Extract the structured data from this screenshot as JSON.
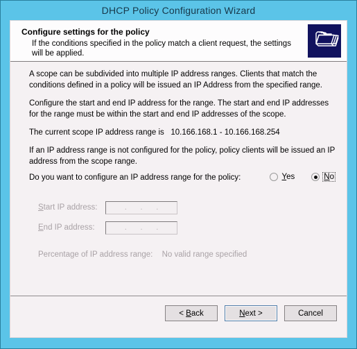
{
  "window": {
    "title": "DHCP Policy Configuration Wizard"
  },
  "banner": {
    "title": "Configure settings for the policy",
    "subtitle": "If the conditions specified in the policy match a client request, the settings will be applied.",
    "icon": "folders-stack-icon"
  },
  "body": {
    "paragraph1": "A scope can be subdivided into multiple IP address ranges. Clients that match the conditions defined in a policy will be issued an IP Address from the specified range.",
    "paragraph2": "Configure the start and end IP address for the range. The start and end IP addresses for the range must be within the start and end IP addresses of the scope.",
    "paragraph3_label": "The current scope IP address range is",
    "paragraph3_value": "10.166.168.1 - 10.166.168.254",
    "paragraph4": "If an IP address range is not configured for the policy, policy clients will be issued an IP address from the scope range.",
    "question": "Do you want to configure an IP address range for the policy:",
    "radios": [
      {
        "label": "Yes",
        "accelerator": "Y",
        "checked": false,
        "focused": false
      },
      {
        "label": "No",
        "accelerator": "N",
        "checked": true,
        "focused": true
      }
    ],
    "fields": [
      {
        "label": "Start IP address:",
        "accelerator": "S",
        "value": "",
        "enabled": false
      },
      {
        "label": "End IP address:",
        "accelerator": "E",
        "value": "",
        "enabled": false
      }
    ],
    "percentage_label": "Percentage of IP address range:",
    "percentage_value": "No valid range specified"
  },
  "footer": {
    "buttons": [
      {
        "name": "back",
        "label": "< Back",
        "accelerator": "B",
        "default": false
      },
      {
        "name": "next",
        "label": "Next >",
        "accelerator": "N",
        "default": true
      },
      {
        "name": "cancel",
        "label": "Cancel",
        "accelerator": "",
        "default": false
      }
    ]
  },
  "colors": {
    "frame": "#5bc4e8",
    "client_bg": "#f5f1f3",
    "icon_bg": "#11125e",
    "default_button_border": "#4f7ca8"
  }
}
